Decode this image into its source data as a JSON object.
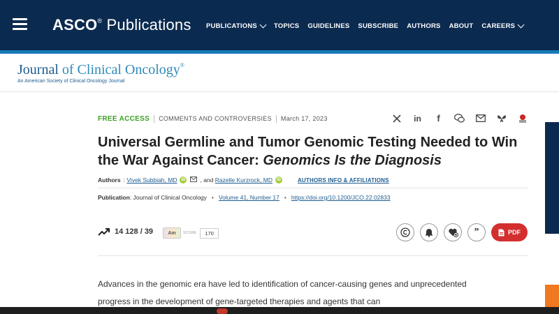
{
  "header": {
    "brand_bold": "ASCO",
    "brand_rest": "Publications",
    "nav": [
      {
        "label": "PUBLICATIONS",
        "dropdown": true
      },
      {
        "label": "TOPICS",
        "dropdown": false
      },
      {
        "label": "GUIDELINES",
        "dropdown": false
      },
      {
        "label": "SUBSCRIBE",
        "dropdown": false
      },
      {
        "label": "AUTHORS",
        "dropdown": false
      },
      {
        "label": "ABOUT",
        "dropdown": false
      },
      {
        "label": "CAREERS",
        "dropdown": true
      }
    ],
    "colors": {
      "bg": "#0b2a4f",
      "stripe": "#1a7ab8"
    }
  },
  "journal": {
    "title_first": "Journal",
    "title_rest": "of Clinical Oncology",
    "reg": "®",
    "subtitle": "An American Society of Clinical Oncology Journal"
  },
  "article": {
    "access": "FREE ACCESS",
    "section": "COMMENTS AND CONTROVERSIES",
    "date": "March 17, 2023",
    "share_icons": [
      "x-icon",
      "linkedin-icon",
      "facebook-icon",
      "wechat-icon",
      "email-icon",
      "bluesky-icon",
      "mendeley-icon"
    ],
    "title_main": "Universal Germline and Tumor Genomic Testing Needed to Win the War Against Cancer:",
    "title_italic": "Genomics Is the Diagnosis",
    "authors_label": "Authors",
    "author1": "Vivek Subbiah, MD",
    "author_joiner": ", and",
    "author2": "Razelle Kurzrock, MD",
    "authors_info": "AUTHORS INFO & AFFILIATIONS",
    "publication_label": "Publication",
    "publication_journal": ": Journal of Clinical Oncology",
    "volume": "Volume 41, Number 17",
    "doi": "https://doi.org/10.1200/JCO.22.02833",
    "metrics": "14 128 / 39",
    "altmetric_badge": "Am",
    "altmetric_label": "SCORE",
    "altmetric_score": "170",
    "pdf_label": "PDF",
    "body": "Advances in the genomic era have led to identification of cancer-causing genes and unprecedented progress in the development of gene-targeted therapies and agents that can"
  }
}
